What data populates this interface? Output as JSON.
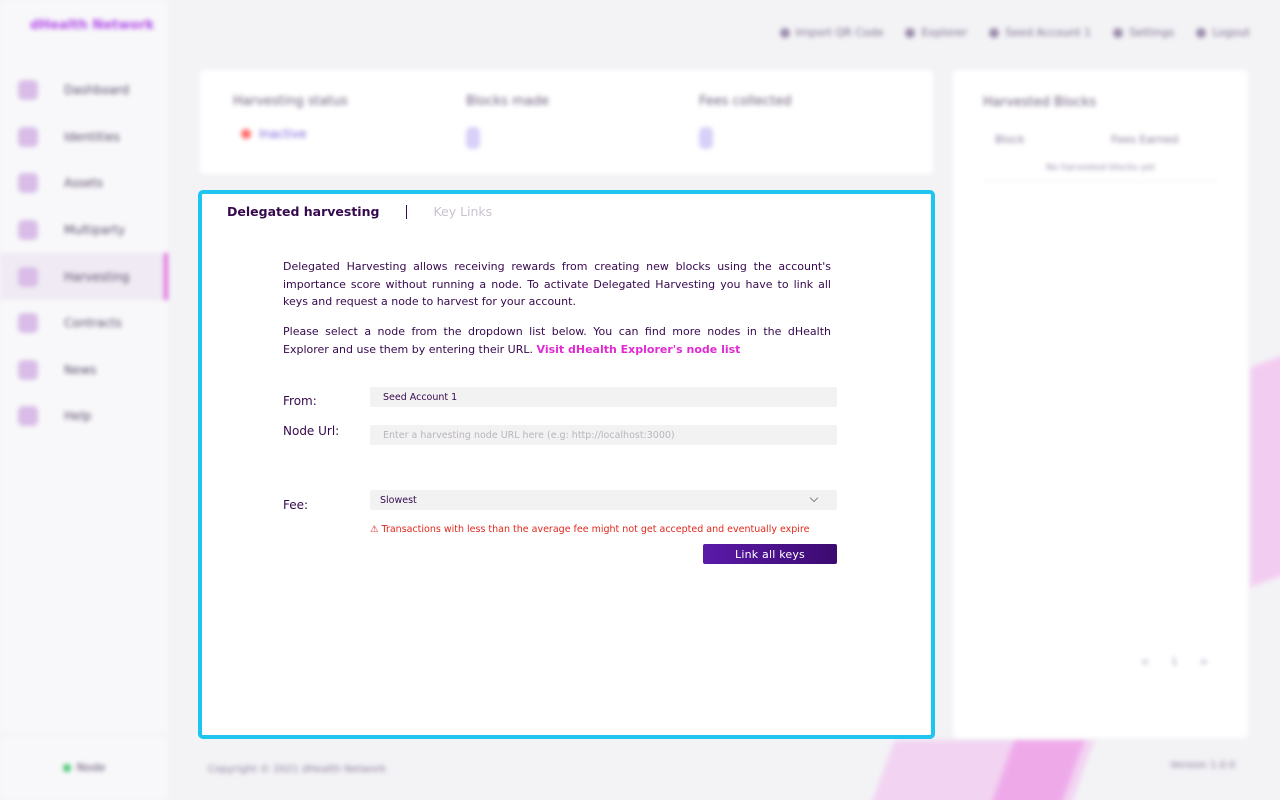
{
  "app": {
    "brand": "dHealth Network"
  },
  "sidebar": {
    "items": [
      {
        "label": "Dashboard",
        "active": false
      },
      {
        "label": "Identities",
        "active": false
      },
      {
        "label": "Assets",
        "active": false
      },
      {
        "label": "Multiparty",
        "active": false
      },
      {
        "label": "Harvesting",
        "active": true
      },
      {
        "label": "Contracts",
        "active": false
      },
      {
        "label": "News",
        "active": false
      },
      {
        "label": "Help",
        "active": false
      }
    ],
    "node_status": "Node"
  },
  "topbar": {
    "items": [
      {
        "label": "Import QR Code",
        "icon": "qr-icon"
      },
      {
        "label": "Explorer",
        "icon": "globe-icon"
      },
      {
        "label": "Seed Account 1",
        "icon": "wallet-icon"
      },
      {
        "label": "Settings",
        "icon": "gear-icon"
      },
      {
        "label": "Logout",
        "icon": "logout-icon"
      }
    ]
  },
  "status": {
    "harvesting_status_label": "Harvesting status",
    "harvesting_status_value": "Inactive",
    "blocks_made_label": "Blocks made",
    "blocks_made_value": "0",
    "fees_collected_label": "Fees collected",
    "fees_collected_value": "0"
  },
  "harvested_blocks": {
    "title": "Harvested Blocks",
    "col_block": "Block",
    "col_fees": "Fees Earned",
    "empty": "No harvested blocks yet",
    "pager": [
      "<",
      "1",
      ">"
    ]
  },
  "form": {
    "tabs": [
      "Delegated harvesting",
      "Key Links"
    ],
    "description_1": "Delegated Harvesting allows receiving rewards from creating new blocks using the account's importance score without running a node. To activate Delegated Harvesting you have to link all keys and request a node to harvest for your account.",
    "description_2": "Please select a node from the dropdown list below. You can find more nodes in the dHealth Explorer and use them by entering their URL.",
    "explorer_link": "Visit dHealth Explorer's node list",
    "from_label": "From:",
    "from_value": "Seed Account 1",
    "node_url_label": "Node Url:",
    "node_url_placeholder": "Enter a harvesting node URL here (e.g: http://localhost:3000)",
    "fee_label": "Fee:",
    "fee_value": "Slowest",
    "fee_warning": "⚠ Transactions with less than the average fee might not get accepted and eventually expire",
    "submit_label": "Link all keys"
  },
  "footer": {
    "copyright": "Copyright © 2021 dHealth Network",
    "version": "Version 1.0.0"
  },
  "colors": {
    "accent_border": "#1ec5ee",
    "primary": "#36094e",
    "link": "#e02ad2",
    "warning": "#e0281c"
  }
}
